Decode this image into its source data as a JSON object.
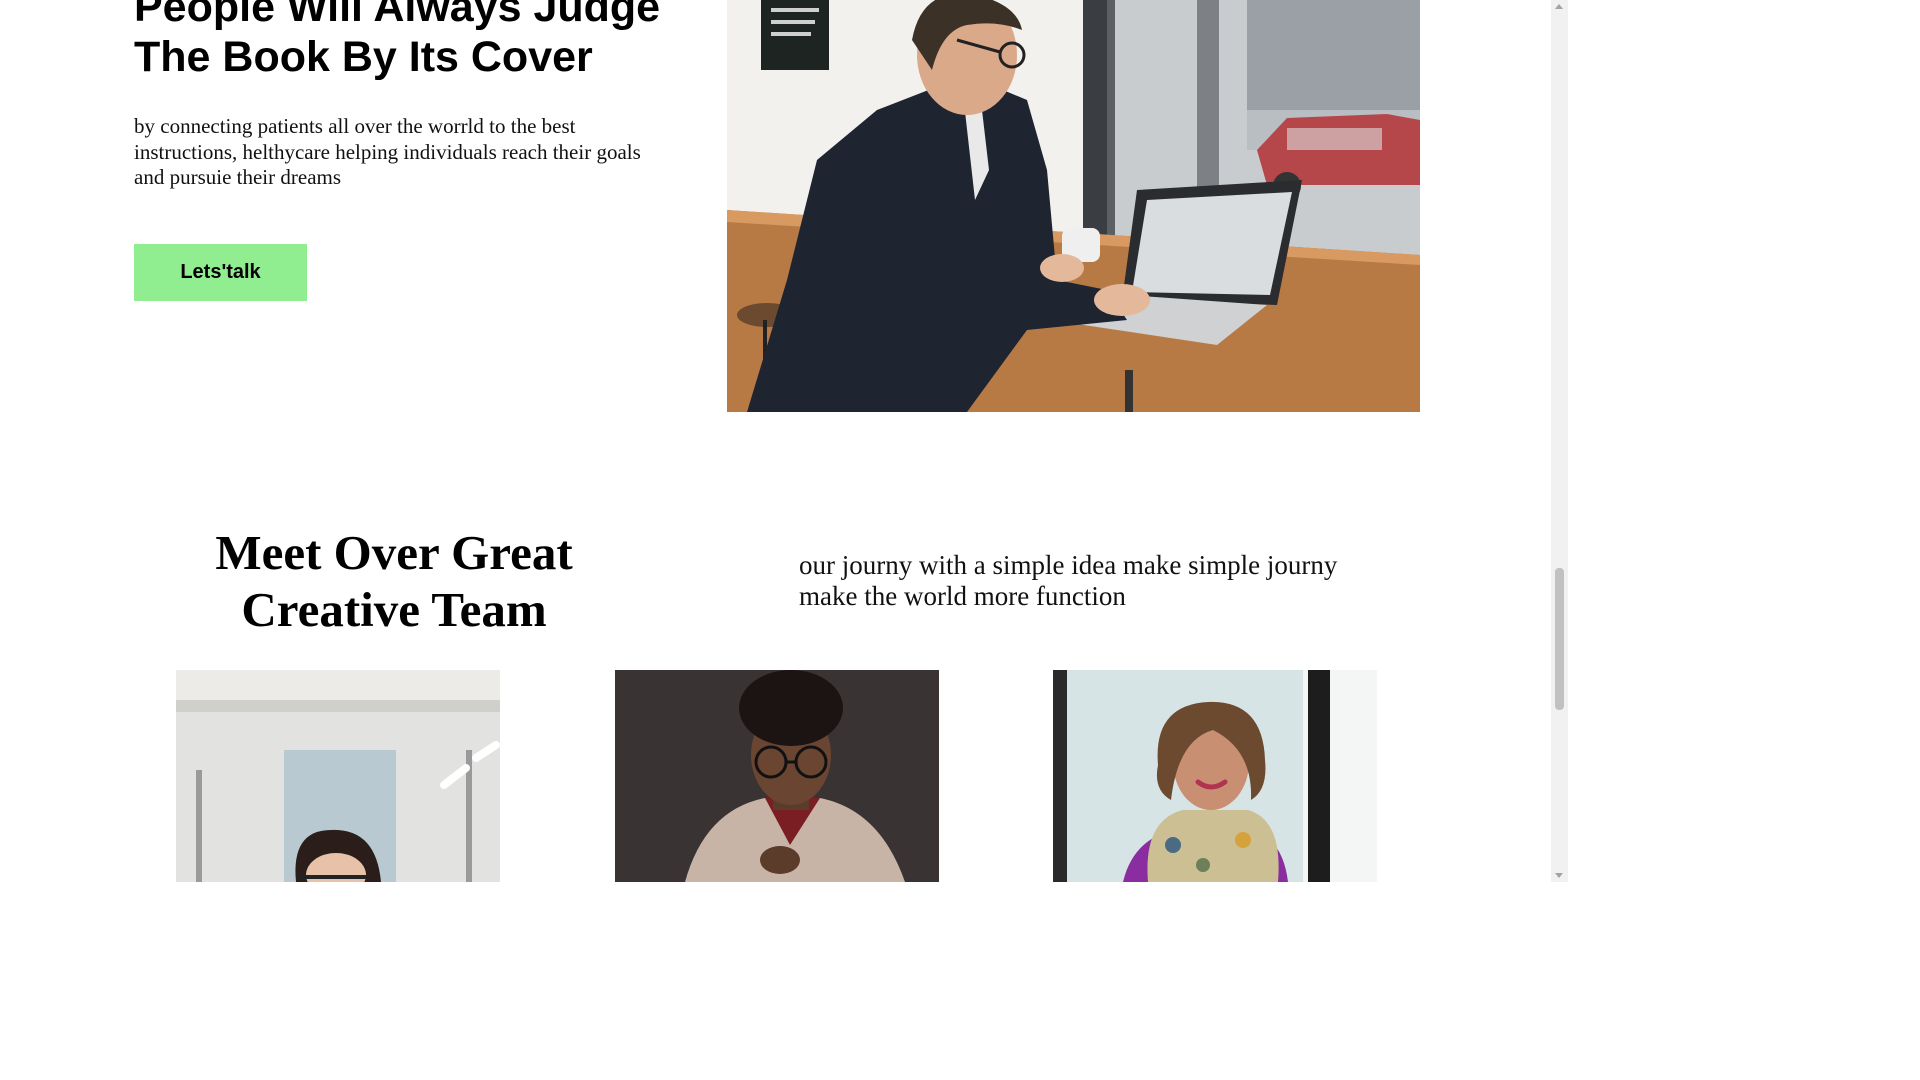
{
  "hero": {
    "title": "People Will Always Judge The Book By Its Cover",
    "description": "by connecting patients all over the worrld to the best instructions, helthycare helping individuals reach their goals and pursuie their dreams",
    "cta_label": "Lets'talk",
    "image": "man-working-on-laptop-in-cafe"
  },
  "team": {
    "title": "Meet Over Great Creative Team",
    "description": "our journy with a simple idea make simple journy make the world more function",
    "members": [
      {
        "image": "woman-with-glasses-in-office"
      },
      {
        "image": "man-with-glasses-in-blazer"
      },
      {
        "image": "woman-with-scarf-smiling"
      }
    ]
  },
  "colors": {
    "cta_background": "#90ee90",
    "text": "#000000",
    "background": "#ffffff"
  }
}
